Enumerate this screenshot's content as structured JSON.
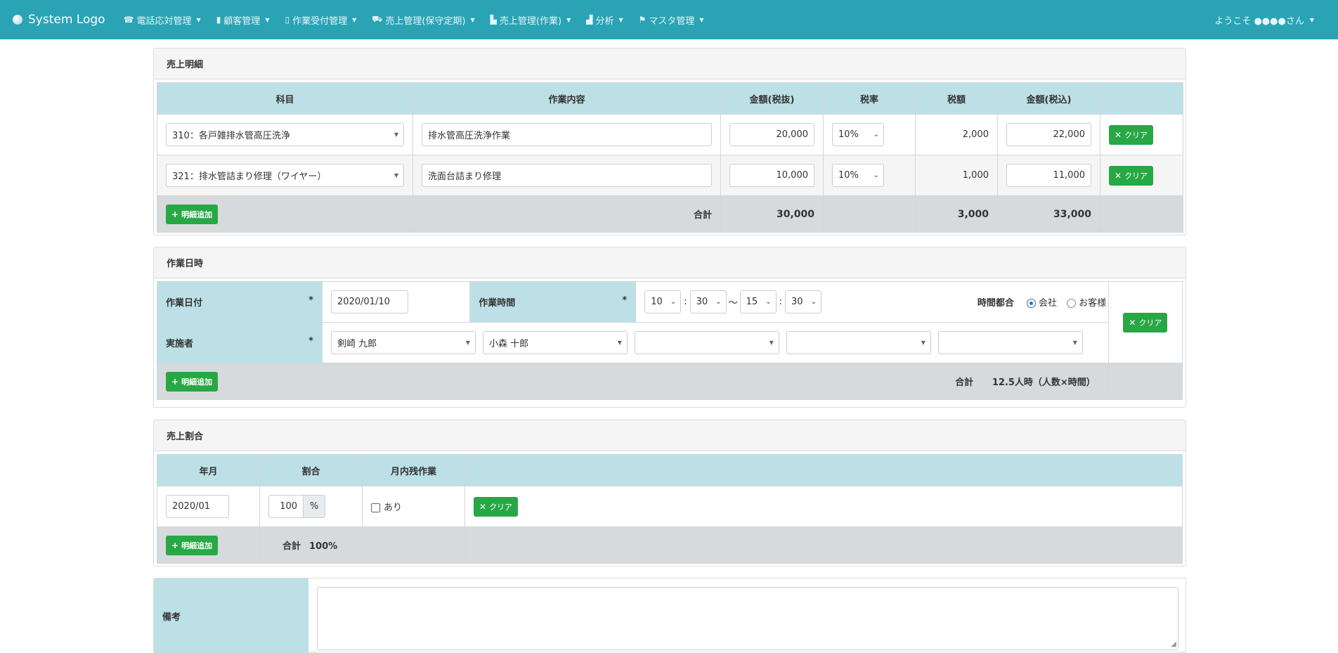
{
  "nav": {
    "brand": "System Logo",
    "items": [
      {
        "label": "電話応対管理",
        "icon": "☎"
      },
      {
        "label": "顧客管理",
        "icon": "▮"
      },
      {
        "label": "作業受付管理",
        "icon": "▯"
      },
      {
        "label": "売上管理(保守定期)",
        "icon": "⛟"
      },
      {
        "label": "売上管理(作業)",
        "icon": "▙"
      },
      {
        "label": "分析",
        "icon": "▟"
      },
      {
        "label": "マスタ管理",
        "icon": "⚑"
      }
    ],
    "welcome": "ようこそ ●●●●さん"
  },
  "sales_detail": {
    "title": "売上明細",
    "headers": [
      "科目",
      "作業内容",
      "金額(税抜)",
      "税率",
      "税額",
      "金額(税込)",
      ""
    ],
    "rows": [
      {
        "subject": "310：各戸雑排水管高圧洗浄",
        "work": "排水管高圧洗浄作業",
        "amount_ex": "20,000",
        "tax_rate": "10%",
        "tax": "2,000",
        "amount_in": "22,000",
        "clear": "クリア"
      },
      {
        "subject": "321：排水管詰まり修理（ワイヤー）",
        "work": "洗面台詰まり修理",
        "amount_ex": "10,000",
        "tax_rate": "10%",
        "tax": "1,000",
        "amount_in": "11,000",
        "clear": "クリア"
      }
    ],
    "add_label": "明細追加",
    "total_label": "合計",
    "total_ex": "30,000",
    "total_tax": "3,000",
    "total_in": "33,000"
  },
  "work_datetime": {
    "title": "作業日時",
    "date_label": "作業日付",
    "required_mark": "*",
    "date_value": "2020/01/10",
    "time_label": "作業時間",
    "start_hour": "10",
    "start_min": "30",
    "tilde": "〜",
    "colon": ":",
    "end_hour": "15",
    "end_min": "30",
    "time_owner_label": "時間都合",
    "radio_company": "会社",
    "radio_customer": "お客様",
    "worker_label": "実施者",
    "workers": [
      "剣崎 九郎",
      "小森 十郎",
      "",
      "",
      ""
    ],
    "clear": "クリア",
    "add_label": "明細追加",
    "total_label": "合計",
    "total_value": "12.5人時（人数×時間）"
  },
  "sales_ratio": {
    "title": "売上割合",
    "headers": [
      "年月",
      "割合",
      "月内残作業",
      ""
    ],
    "row": {
      "year_month": "2020/01",
      "ratio": "100",
      "pct": "%",
      "remaining": "あり",
      "clear": "クリア"
    },
    "add_label": "明細追加",
    "total_label": "合計",
    "total_value": "100%"
  },
  "notes": {
    "label": "備考",
    "value": ""
  }
}
